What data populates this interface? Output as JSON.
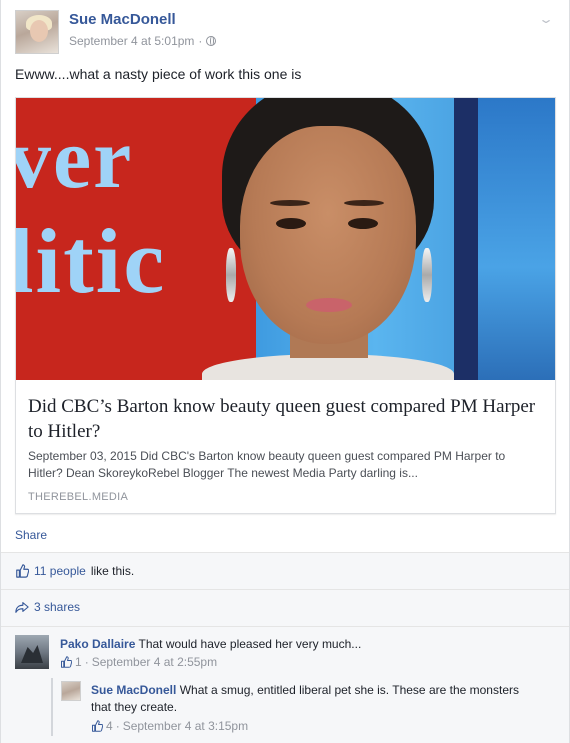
{
  "post": {
    "author": "Sue MacDonell",
    "timestamp": "September 4 at 5:01pm",
    "meta_separator": "·",
    "privacy_icon": "globe-icon",
    "text": "Ewww....what a nasty piece of work this one is"
  },
  "link_card": {
    "image_text_top": "ver",
    "image_text_bottom": "litic",
    "title": "Did CBC’s Barton know beauty queen guest compared PM Harper to Hitler?",
    "description": "September 03, 2015 Did CBC's Barton know beauty queen guest compared PM Harper to Hitler? Dean SkoreykoRebel Blogger The newest Media Party darling is...",
    "domain": "THEREBEL.MEDIA"
  },
  "actions": {
    "share_label": "Share"
  },
  "reactions": {
    "likes_link": "11 people",
    "likes_suffix": "like this.",
    "shares_label": "3 shares"
  },
  "comments": [
    {
      "author": "Pako Dallaire",
      "text": "That would have pleased her very much...",
      "likes": "1",
      "separator": "·",
      "timestamp": "September 4 at 2:55pm"
    },
    {
      "author": "Sue MacDonell",
      "text": "What a smug, entitled liberal pet she is. These are the monsters that they create.",
      "likes": "4",
      "separator": "·",
      "timestamp": "September 4 at 3:15pm"
    }
  ],
  "colors": {
    "link_blue": "#365899",
    "meta_gray": "#90949c",
    "text_dark": "#1d2129",
    "comment_bg": "#f6f7f9"
  }
}
